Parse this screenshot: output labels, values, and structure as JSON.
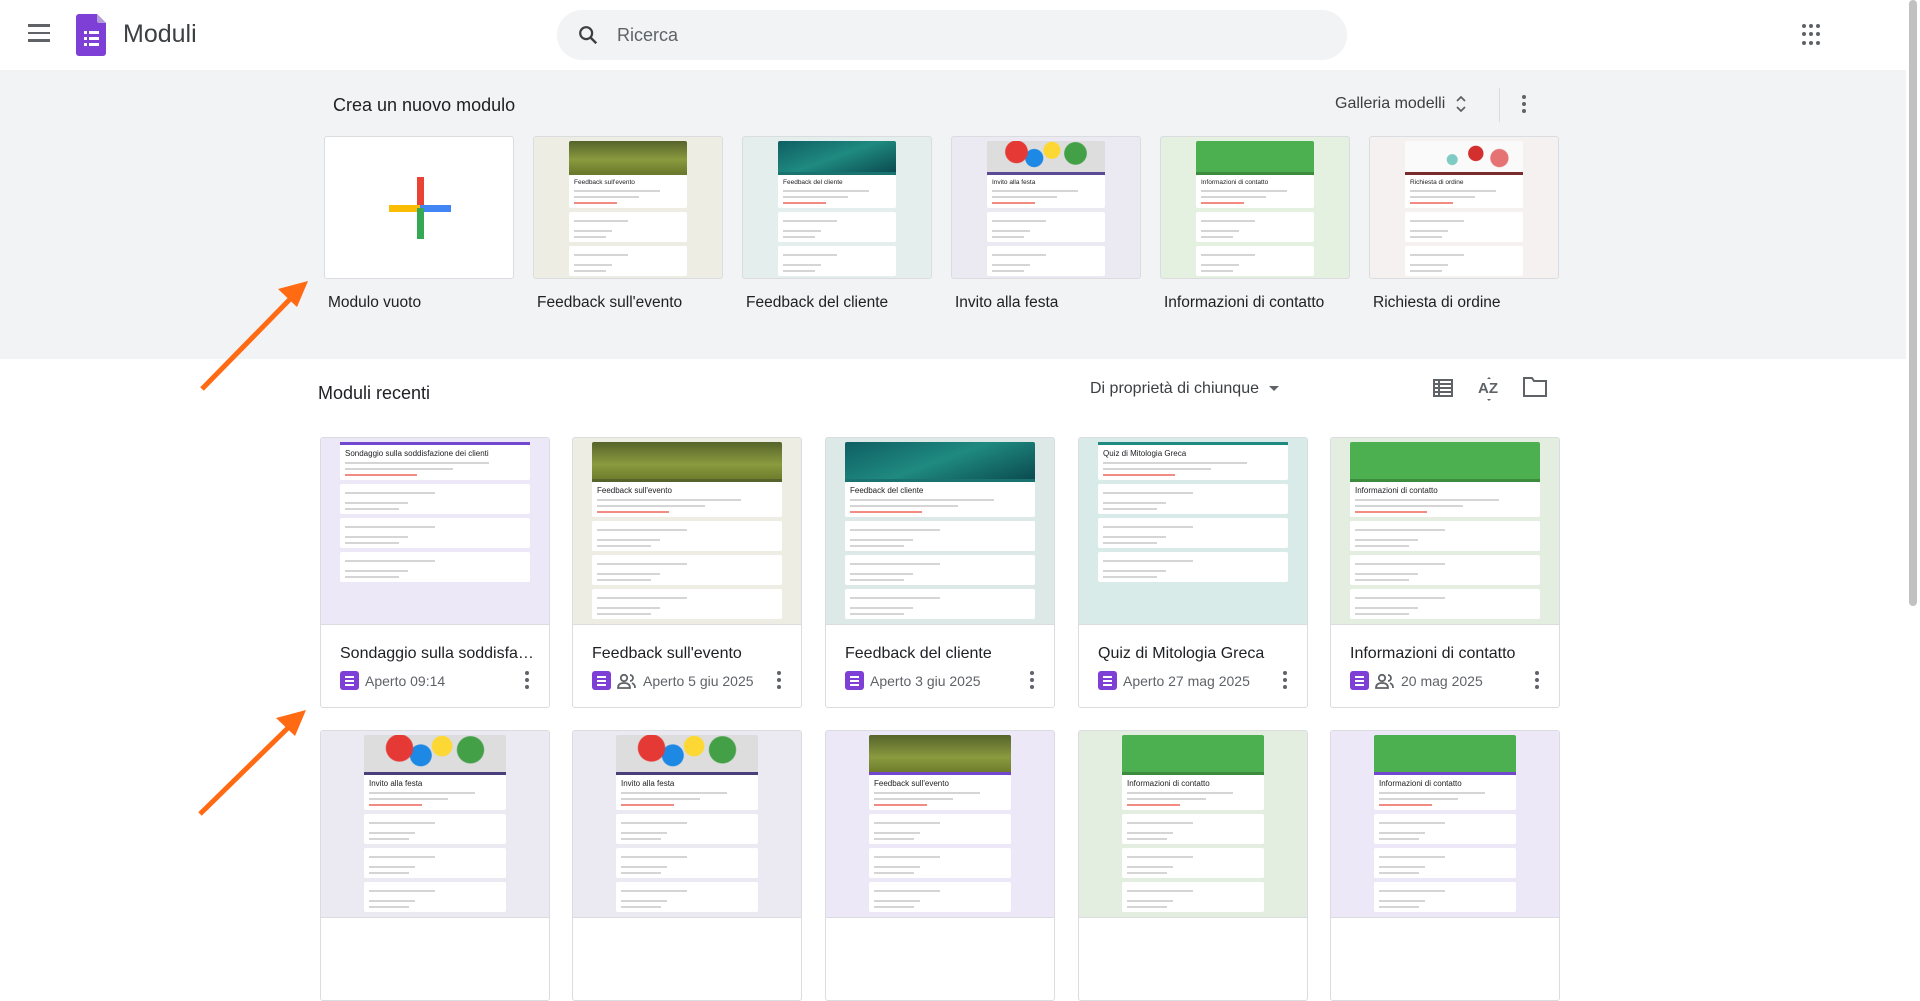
{
  "header": {
    "app_name": "Moduli",
    "search_placeholder": "Ricerca"
  },
  "templates": {
    "title": "Crea un nuovo modulo",
    "gallery_label": "Galleria modelli",
    "items": [
      {
        "label": "Modulo vuoto",
        "blank": true
      },
      {
        "label": "Feedback sull'evento",
        "thumb_title": "Feedback sull'evento",
        "bg": "#eeede4",
        "banner": "linear-gradient(180deg,#56642b,#8a9a3e 60%,#6f7d2d)",
        "accent": "#6b7a2e"
      },
      {
        "label": "Feedback del cliente",
        "thumb_title": "Feedback del cliente",
        "bg": "#e4efed",
        "banner": "linear-gradient(160deg,#0f5e63,#1f8a80 50%,#0b4b50)",
        "accent": "#1a7370"
      },
      {
        "label": "Invito alla festa",
        "thumb_title": "Invito alla festa",
        "bg": "#ebeaf2",
        "banner": "radial-gradient(circle at 25% 35%,#e53935 12%,transparent 13%),radial-gradient(circle at 55% 30%,#fdd835 12%,transparent 13%),radial-gradient(circle at 75% 40%,#43a047 12%,transparent 13%),radial-gradient(circle at 40% 55%,#1e88e5 12%,transparent 13%),#ddd",
        "accent": "#5c4a94"
      },
      {
        "label": "Informazioni di contatto",
        "thumb_title": "Informazioni di contatto",
        "bg": "#e4f0e0",
        "banner": "#4caf50",
        "accent": "#3d8b3d"
      },
      {
        "label": "Richiesta di ordine",
        "thumb_title": "Richiesta di ordine",
        "bg": "#f6f1f1",
        "banner": "radial-gradient(circle at 60% 40%,#d32f2f 10%,transparent 11%),radial-gradient(circle at 80% 55%,#e57373 9%,transparent 10%),radial-gradient(circle at 40% 60%,#80cbc4 7%,transparent 8%),#fafafa",
        "accent": "#7a2b2b"
      }
    ]
  },
  "recent": {
    "title": "Moduli recenti",
    "owner_filter": "Di proprietà di chiunque",
    "row1": [
      {
        "title": "Sondaggio sulla soddisfaz...",
        "thumb_title": "Sondaggio sulla soddisfazione dei clienti",
        "meta": "Aperto 09:14",
        "shared": false,
        "bg": "#ece8f7",
        "banner": "",
        "accent": "#7248d0"
      },
      {
        "title": "Feedback sull'evento",
        "thumb_title": "Feedback sull'evento",
        "meta": "Aperto 5 giu 2025",
        "shared": true,
        "bg": "#eeede4",
        "banner": "linear-gradient(180deg,#56642b,#8a9a3e 60%,#6f7d2d)",
        "accent": "#56642b"
      },
      {
        "title": "Feedback del cliente",
        "thumb_title": "Feedback del cliente",
        "meta": "Aperto 3 giu 2025",
        "shared": false,
        "bg": "#dde9e7",
        "banner": "linear-gradient(160deg,#0f5e63,#1f8a80 50%,#0b4b50)",
        "accent": "#1a7370"
      },
      {
        "title": "Quiz di Mitologia Greca",
        "thumb_title": "Quiz di Mitologia Greca",
        "meta": "Aperto 27 mag 2025",
        "shared": false,
        "bg": "#d9ebe9",
        "banner": "",
        "accent": "#1f8a80"
      },
      {
        "title": "Informazioni di contatto",
        "thumb_title": "Informazioni di contatto",
        "meta": "20 mag 2025",
        "shared": true,
        "bg": "#e3eee0",
        "banner": "#4caf50",
        "accent": "#3d8b3d"
      }
    ],
    "row2": [
      {
        "thumb_title": "Invito alla festa",
        "bg": "#ebeaf2",
        "banner": "radial-gradient(circle at 25% 35%,#e53935 12%,transparent 13%),radial-gradient(circle at 55% 30%,#fdd835 12%,transparent 13%),radial-gradient(circle at 75% 40%,#43a047 12%,transparent 13%),radial-gradient(circle at 40% 55%,#1e88e5 12%,transparent 13%),#ddd",
        "accent": "#4a3f7a"
      },
      {
        "thumb_title": "Invito alla festa",
        "bg": "#ebeaf2",
        "banner": "radial-gradient(circle at 25% 35%,#e53935 12%,transparent 13%),radial-gradient(circle at 55% 30%,#fdd835 12%,transparent 13%),radial-gradient(circle at 75% 40%,#43a047 12%,transparent 13%),radial-gradient(circle at 40% 55%,#1e88e5 12%,transparent 13%),#ddd",
        "accent": "#4a3f7a"
      },
      {
        "thumb_title": "Feedback sull'evento",
        "bg": "#ece8f7",
        "banner": "linear-gradient(180deg,#56642b,#8a9a3e 60%,#6f7d2d)",
        "accent": "#7248d0"
      },
      {
        "thumb_title": "Informazioni di contatto",
        "bg": "#e3eee0",
        "banner": "#4caf50",
        "accent": "#3d8b3d"
      },
      {
        "thumb_title": "Informazioni di contatto",
        "bg": "#ece8f7",
        "banner": "#4caf50",
        "accent": "#7248d0"
      }
    ]
  },
  "colors": {
    "annotation_arrow": "#ff6a13",
    "forms_purple": "#7e3fd6"
  }
}
